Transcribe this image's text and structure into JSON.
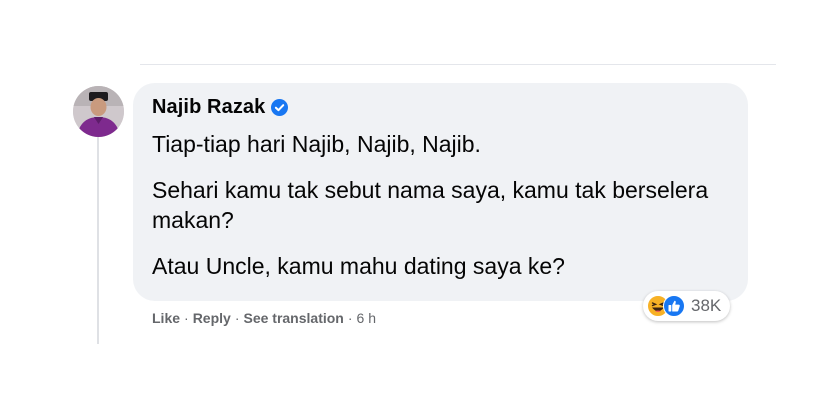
{
  "comment": {
    "author": "Najib Razak",
    "paragraphs": [
      "Tiap-tiap hari Najib, Najib, Najib.",
      "Sehari kamu tak sebut nama saya, kamu tak berselera makan?",
      "Atau Uncle, kamu mahu dating saya ke?"
    ],
    "reactions": {
      "icons": [
        "haha-icon",
        "like-icon"
      ],
      "count": "38K"
    },
    "actions": {
      "like": "Like",
      "reply": "Reply",
      "translate": "See translation",
      "separator": "·",
      "time": "6 h"
    }
  },
  "colors": {
    "bubble": "#f0f2f5",
    "text": "#050505",
    "secondary_text": "#65676b",
    "verified": "#1877f2",
    "like": "#1877f2",
    "haha": "#f7b125"
  }
}
